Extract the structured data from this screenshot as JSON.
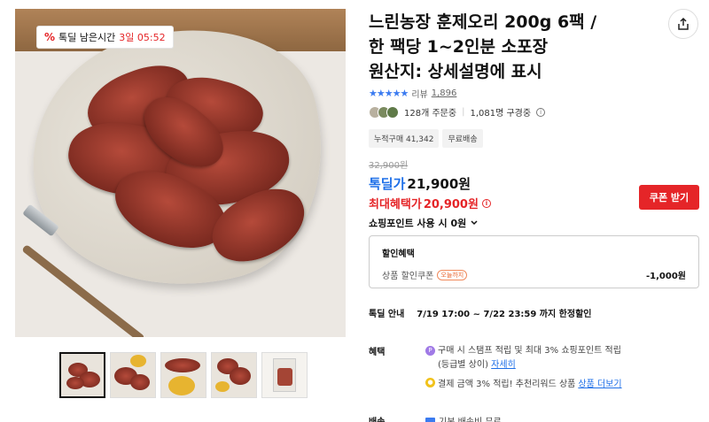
{
  "badge": {
    "pct_icon": "%",
    "label": "톡딜 남은시간",
    "time": "3일 05:52"
  },
  "product": {
    "title_lines": [
      "느린농장 훈제오리 200g 6팩 /",
      "한 팩당 1~2인분 소포장",
      "원산지: 상세설명에 표시"
    ]
  },
  "rating": {
    "stars": "★★★★★",
    "review_label": "리뷰",
    "review_count": "1,896"
  },
  "orders": {
    "order_text": "128개 주문중",
    "subscriber_text": "1,081명 구경중"
  },
  "tags": [
    "누적구매 41,342",
    "무료배송"
  ],
  "price": {
    "original": "32,900원",
    "deal_label": "톡딜가",
    "deal_price": "21,900원",
    "max_label": "최대혜택가",
    "max_price": "20,900원",
    "coupon_button": "쿠폰 받기",
    "points_text": "쇼핑포인트 사용 시 0원"
  },
  "discount": {
    "header": "할인혜택",
    "item_label": "상품 할인쿠폰",
    "item_badge": "오늘까지",
    "item_amount": "-1,000원"
  },
  "deal_guide": {
    "label": "톡딜 안내",
    "text": "7/19 17:00 ~ 7/22 23:59 까지 한정할인"
  },
  "benefits": {
    "label": "혜택",
    "b1_icon": "P",
    "b1_text": "구매 시 스탬프 적립 및 최대 3% 쇼핑포인트 적립",
    "b1_sub": "(등급별 상이)",
    "b1_link": "자세히",
    "b2_icon": "●",
    "b2_text": "결제 금액 3% 적립! 추천리워드 상품",
    "b2_link": "상품 더보기"
  },
  "shipping": {
    "label": "배송",
    "text": "기본 배송비 무료"
  },
  "colors": {
    "accent_red": "#e52528",
    "accent_blue": "#1e6fe8"
  }
}
